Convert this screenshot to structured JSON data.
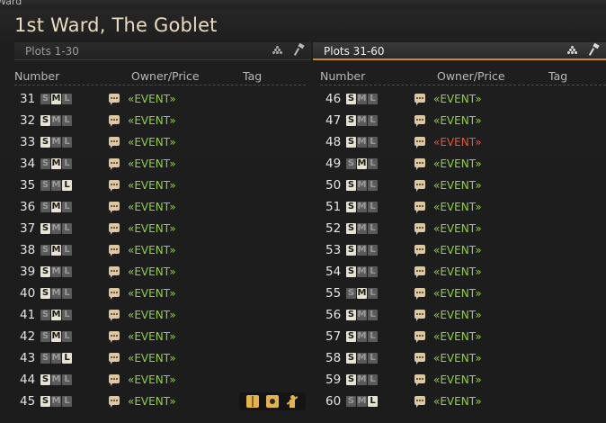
{
  "window": {
    "strip_title": "Ward",
    "title": "1st Ward, The Goblet"
  },
  "tabs": [
    {
      "label": "Plots 1-30",
      "active": false
    },
    {
      "label": "Plots 31-60",
      "active": true
    }
  ],
  "headers": {
    "number": "Number",
    "owner": "Owner/Price",
    "tag": "Tag"
  },
  "size_letters": [
    "S",
    "M",
    "L"
  ],
  "colors": {
    "event_green": "#8fd14a",
    "event_red": "#e8533a",
    "accent": "#d0882c"
  },
  "plots_left": [
    {
      "number": "31",
      "size": "M",
      "owner": "«EVENT»",
      "status": "green"
    },
    {
      "number": "32",
      "size": "S",
      "owner": "«EVENT»",
      "status": "green"
    },
    {
      "number": "33",
      "size": "S",
      "owner": "«EVENT»",
      "status": "green"
    },
    {
      "number": "34",
      "size": "M",
      "owner": "«EVENT»",
      "status": "green"
    },
    {
      "number": "35",
      "size": "L",
      "owner": "«EVENT»",
      "status": "green"
    },
    {
      "number": "36",
      "size": "M",
      "owner": "«EVENT»",
      "status": "green"
    },
    {
      "number": "37",
      "size": "S",
      "owner": "«EVENT»",
      "status": "green"
    },
    {
      "number": "38",
      "size": "M",
      "owner": "«EVENT»",
      "status": "green"
    },
    {
      "number": "39",
      "size": "S",
      "owner": "«EVENT»",
      "status": "green"
    },
    {
      "number": "40",
      "size": "S",
      "owner": "«EVENT»",
      "status": "green"
    },
    {
      "number": "41",
      "size": "M",
      "owner": "«EVENT»",
      "status": "green"
    },
    {
      "number": "42",
      "size": "M",
      "owner": "«EVENT»",
      "status": "green"
    },
    {
      "number": "43",
      "size": "L",
      "owner": "«EVENT»",
      "status": "green"
    },
    {
      "number": "44",
      "size": "S",
      "owner": "«EVENT»",
      "status": "green"
    },
    {
      "number": "45",
      "size": "S",
      "owner": "«EVENT»",
      "status": "green"
    }
  ],
  "plots_right": [
    {
      "number": "46",
      "size": "S",
      "owner": "«EVENT»",
      "status": "green"
    },
    {
      "number": "47",
      "size": "S",
      "owner": "«EVENT»",
      "status": "green"
    },
    {
      "number": "48",
      "size": "S",
      "owner": "«EVENT»",
      "status": "red"
    },
    {
      "number": "49",
      "size": "M",
      "owner": "«EVENT»",
      "status": "green"
    },
    {
      "number": "50",
      "size": "S",
      "owner": "«EVENT»",
      "status": "green"
    },
    {
      "number": "51",
      "size": "S",
      "owner": "«EVENT»",
      "status": "green"
    },
    {
      "number": "52",
      "size": "S",
      "owner": "«EVENT»",
      "status": "green"
    },
    {
      "number": "53",
      "size": "S",
      "owner": "«EVENT»",
      "status": "green"
    },
    {
      "number": "54",
      "size": "S",
      "owner": "«EVENT»",
      "status": "green"
    },
    {
      "number": "55",
      "size": "M",
      "owner": "«EVENT»",
      "status": "green"
    },
    {
      "number": "56",
      "size": "S",
      "owner": "«EVENT»",
      "status": "green"
    },
    {
      "number": "57",
      "size": "S",
      "owner": "«EVENT»",
      "status": "green"
    },
    {
      "number": "58",
      "size": "S",
      "owner": "«EVENT»",
      "status": "green"
    },
    {
      "number": "59",
      "size": "S",
      "owner": "«EVENT»",
      "status": "green"
    },
    {
      "number": "60",
      "size": "L",
      "owner": "«EVENT»",
      "status": "green"
    }
  ],
  "tag_icons": {
    "row": "45",
    "icons": [
      "book-icon",
      "camera-icon",
      "person-icon"
    ]
  }
}
